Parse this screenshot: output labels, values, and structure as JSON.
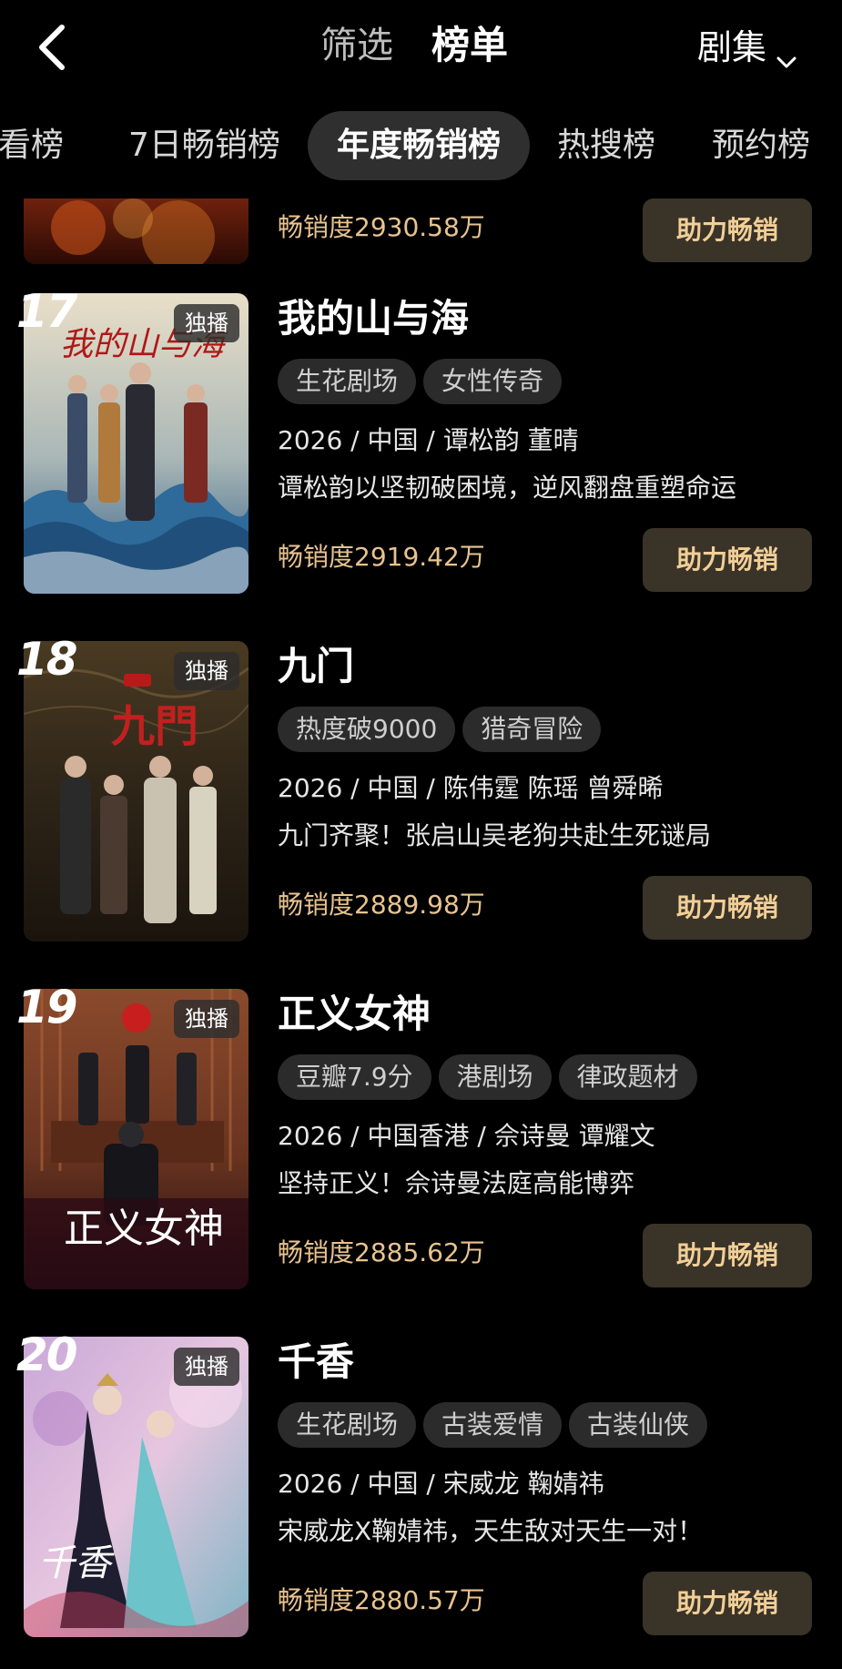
{
  "header": {
    "filter_label": "筛选",
    "ranking_label": "榜单",
    "type_select": "剧集"
  },
  "rank_tabs": [
    {
      "label": "小看榜"
    },
    {
      "label": "7日畅销榜"
    },
    {
      "label": "年度畅销榜",
      "active": true
    },
    {
      "label": "热搜榜"
    },
    {
      "label": "预约榜"
    }
  ],
  "list": {
    "partial_item": {
      "sales": "畅销度2930.58万",
      "button": "助力畅销"
    },
    "items": [
      {
        "rank": "17",
        "badge": "独播",
        "title": "我的山与海",
        "tags": [
          "生花剧场",
          "女性传奇"
        ],
        "meta": "2026 / 中国 / 谭松韵 董晴",
        "desc": "谭松韵以坚韧破困境，逆风翻盘重塑命运",
        "sales": "畅销度2919.42万",
        "button": "助力畅销"
      },
      {
        "rank": "18",
        "badge": "独播",
        "title": "九门",
        "tags": [
          "热度破9000",
          "猎奇冒险"
        ],
        "meta": "2026 / 中国 / 陈伟霆 陈瑶 曾舜晞",
        "desc": "九门齐聚！张启山吴老狗共赴生死谜局",
        "sales": "畅销度2889.98万",
        "button": "助力畅销"
      },
      {
        "rank": "19",
        "badge": "独播",
        "title": "正义女神",
        "tags": [
          "豆瓣7.9分",
          "港剧场",
          "律政题材"
        ],
        "meta": "2026 / 中国香港 / 佘诗曼 谭耀文",
        "desc": "坚持正义！佘诗曼法庭高能博弈",
        "sales": "畅销度2885.62万",
        "button": "助力畅销"
      },
      {
        "rank": "20",
        "badge": "独播",
        "title": "千香",
        "tags": [
          "生花剧场",
          "古装爱情",
          "古装仙侠"
        ],
        "meta": "2026 / 中国 / 宋威龙 鞠婧祎",
        "desc": "宋威龙X鞠婧祎，天生敌对天生一对！",
        "sales": "畅销度2880.57万",
        "button": "助力畅销"
      }
    ]
  },
  "poster_text": {
    "p17": "我的山与海",
    "p18": "九門",
    "p19": "正义女神",
    "p20": "千香"
  },
  "colors": {
    "background": "#000000",
    "accent_gold": "#e8c38f",
    "button_bg": "#3a3328",
    "tag_bg": "#2b2b2b"
  }
}
